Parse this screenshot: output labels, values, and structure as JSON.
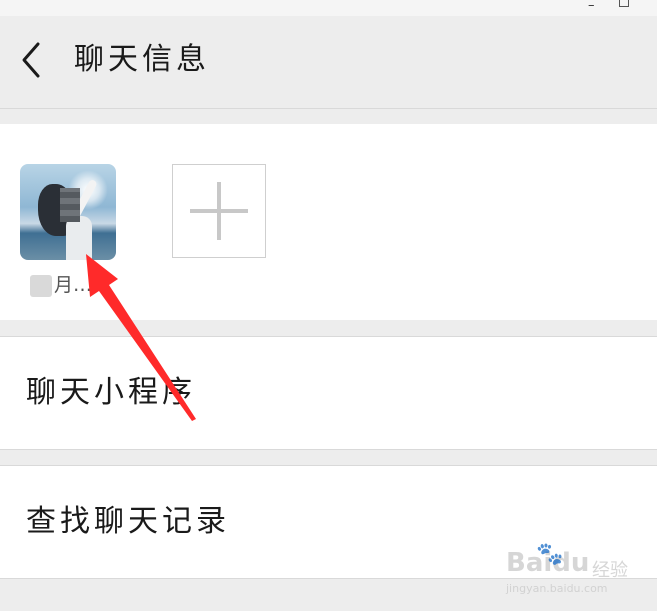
{
  "window": {
    "minimize_glyph": "–"
  },
  "header": {
    "title": "聊天信息",
    "back_icon": "chevron-left-icon"
  },
  "members": [
    {
      "name": "月…"
    }
  ],
  "add_member_icon": "plus-icon",
  "rows": [
    {
      "label": "聊天小程序"
    },
    {
      "label": "查找聊天记录"
    }
  ],
  "annotation": {
    "color": "#ff2a2a"
  },
  "watermark": {
    "brand": "Baidu",
    "brand_cn": "经验",
    "url": "jingyan.baidu.com"
  }
}
